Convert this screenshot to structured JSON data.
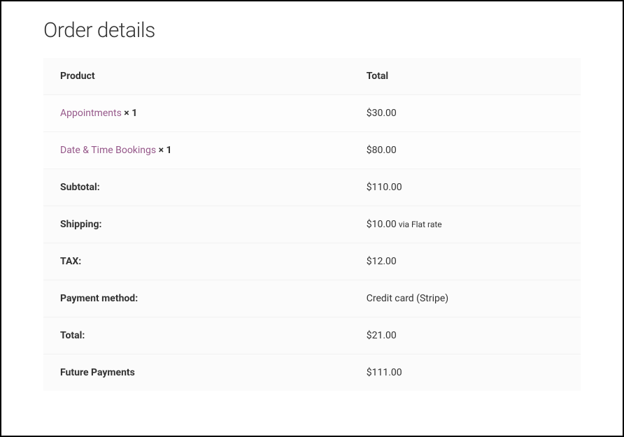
{
  "title": "Order details",
  "columns": {
    "product": "Product",
    "total": "Total"
  },
  "items": [
    {
      "name": "Appointments",
      "qty_prefix": " × ",
      "qty": "1",
      "total": "$30.00"
    },
    {
      "name": "Date & Time Bookings",
      "qty_prefix": " × ",
      "qty": "1",
      "total": "$80.00"
    }
  ],
  "summary": {
    "subtotal_label": "Subtotal:",
    "subtotal_value": "$110.00",
    "shipping_label": "Shipping:",
    "shipping_value": "$10.00",
    "shipping_via": " via Flat rate",
    "tax_label": "TAX:",
    "tax_value": "$12.00",
    "payment_method_label": "Payment method:",
    "payment_method_value": "Credit card (Stripe)",
    "total_label": "Total:",
    "total_value": "$21.00",
    "future_payments_label": "Future Payments",
    "future_payments_value": "$111.00"
  }
}
